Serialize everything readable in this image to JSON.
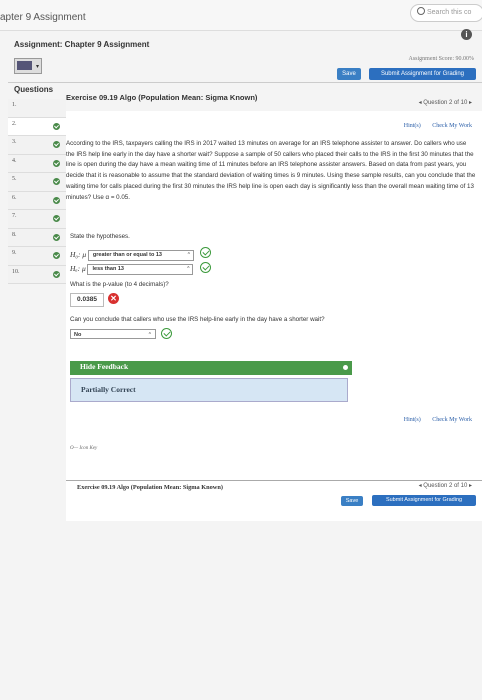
{
  "header": {
    "chapter_title": "apter 9 Assignment",
    "search_placeholder": "Search this co",
    "assignment_label": "Assignment: Chapter 9 Assignment",
    "score": "Assignment Score: 90.00%",
    "save_label": "Save",
    "submit_label": "Submit Assignment for Grading"
  },
  "questions": {
    "heading": "Questions",
    "items": [
      {
        "num": "1."
      },
      {
        "num": "2."
      },
      {
        "num": "3."
      },
      {
        "num": "4."
      },
      {
        "num": "5."
      },
      {
        "num": "6."
      },
      {
        "num": "7."
      },
      {
        "num": "8."
      },
      {
        "num": "9."
      },
      {
        "num": "10."
      }
    ]
  },
  "exercise": {
    "title": "Exercise 09.19 Algo (Population Mean: Sigma Known)",
    "question_nav": "◂ Question 2 of 10 ▸",
    "hints_label": "Hint(s)",
    "check_label": "Check My Work",
    "problem_text": "According to the IRS, taxpayers calling the IRS in 2017 waited 13 minutes on average for an IRS telephone assister to answer. Do callers who use the IRS help line early in the day have a shorter wait? Suppose a sample of 50 callers who placed their calls to the IRS in the first 30 minutes that the line is open during the day have a mean waiting time of 11 minutes before an IRS telephone assister answers. Based on data from past years, you decide that it is reasonable to assume that the standard deviation of waiting times is 9 minutes. Using these sample results, can you conclude that the waiting time for calls placed during the first 30 minutes the IRS help line is open each day is significantly less than the overall mean waiting time of 13 minutes? Use α = 0.05.",
    "state_hyp": "State the hypotheses.",
    "h0_symbol": "H₀: μ",
    "h0_value": "greater than or equal to 13",
    "ha_symbol": "Hₐ: μ",
    "ha_value": "less than 13",
    "pvalue_prompt": "What is the p-value (to 4 decimals)?",
    "pvalue_answer": "0.0385",
    "conclude_prompt": "Can you conclude that callers who use the IRS help-line early in the day have a shorter wait?",
    "conclude_answer": "No",
    "feedback_toggle": "Hide Feedback",
    "feedback_result": "Partially Correct",
    "icon_key": "Icon Key",
    "bottom_title": "Exercise 09.19 Algo (Population Mean: Sigma Known)"
  }
}
